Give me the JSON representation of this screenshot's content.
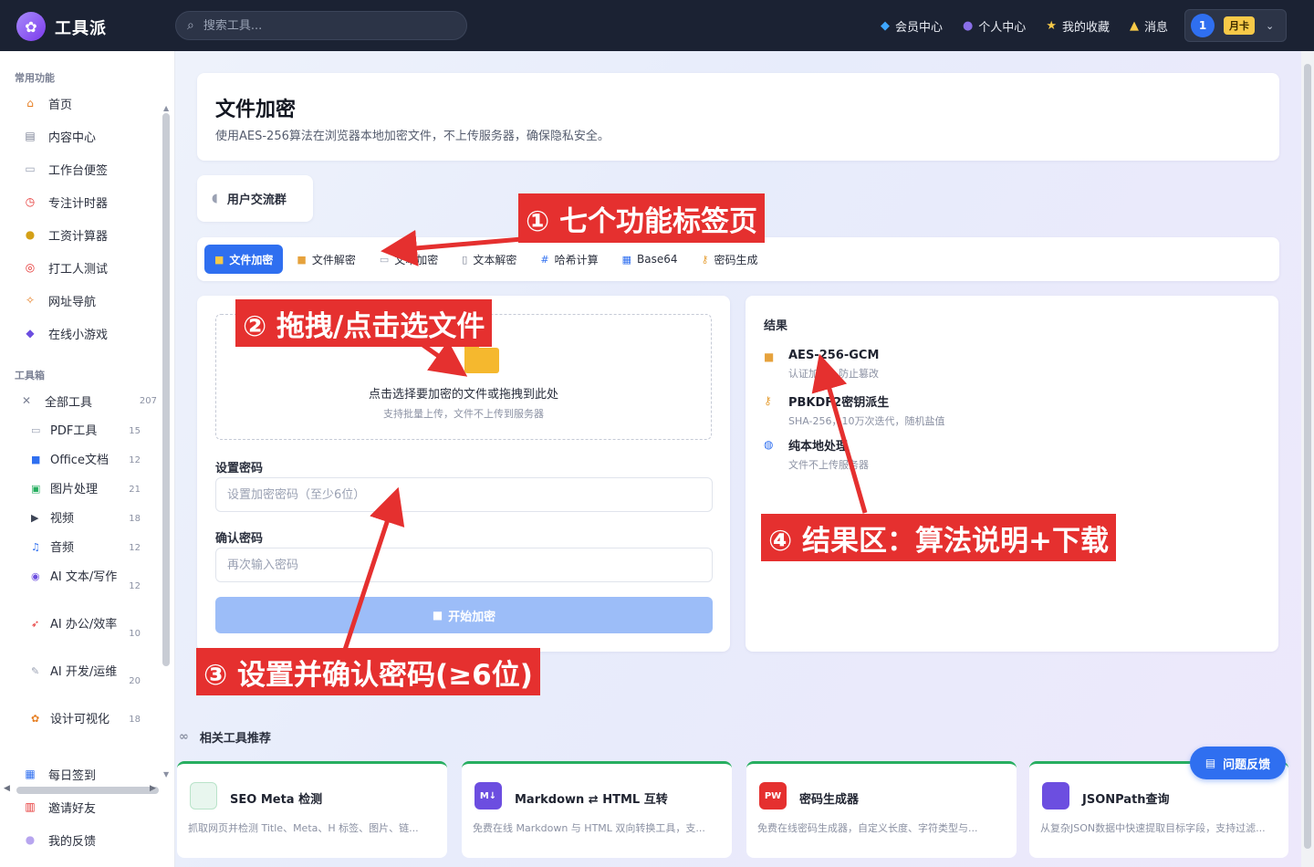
{
  "header": {
    "logo_text": "工具派",
    "search_placeholder": "搜索工具...",
    "nav": [
      {
        "label": "会员中心",
        "icon": "gem-icon"
      },
      {
        "label": "个人中心",
        "icon": "user-icon"
      },
      {
        "label": "我的收藏",
        "icon": "star-icon"
      },
      {
        "label": "消息",
        "icon": "bell-icon"
      }
    ],
    "user_avatar": "1",
    "user_badge": "月卡"
  },
  "sidebar": {
    "section_common": "常用功能",
    "common_items": [
      {
        "label": "首页",
        "icon": "home-icon"
      },
      {
        "label": "内容中心",
        "icon": "news-icon"
      },
      {
        "label": "工作台便签",
        "icon": "note-icon"
      },
      {
        "label": "专注计时器",
        "icon": "timer-icon"
      },
      {
        "label": "工资计算器",
        "icon": "money-bag-icon"
      },
      {
        "label": "打工人测试",
        "icon": "target-icon"
      },
      {
        "label": "网址导航",
        "icon": "compass-icon"
      },
      {
        "label": "在线小游戏",
        "icon": "gamepad-icon"
      }
    ],
    "section_tools": "工具箱",
    "all_tools": {
      "label": "全部工具",
      "count": "207"
    },
    "tool_items": [
      {
        "label": "PDF工具",
        "count": "15",
        "icon": "pdf-icon"
      },
      {
        "label": "Office文档",
        "count": "12",
        "icon": "office-icon"
      },
      {
        "label": "图片处理",
        "count": "21",
        "icon": "image-icon"
      },
      {
        "label": "视频",
        "count": "18",
        "icon": "video-icon"
      },
      {
        "label": "音频",
        "count": "12",
        "icon": "music-icon"
      },
      {
        "label": "AI 文本/写作",
        "count": "12",
        "icon": "robot-icon"
      },
      {
        "label": "AI 办公/效率",
        "count": "10",
        "icon": "rocket-icon"
      },
      {
        "label": "AI 开发/运维",
        "count": "20",
        "icon": "wrench-icon"
      },
      {
        "label": "设计可视化",
        "count": "18",
        "icon": "palette-icon"
      }
    ],
    "bottom_items": [
      {
        "label": "每日签到",
        "icon": "calendar-icon"
      },
      {
        "label": "邀请好友",
        "icon": "gift-icon"
      },
      {
        "label": "我的反馈",
        "icon": "chat-icon"
      }
    ]
  },
  "hero": {
    "title": "文件加密",
    "desc": "使用AES-256算法在浏览器本地加密文件，不上传服务器，确保隐私安全。"
  },
  "group_button": "用户交流群",
  "tabs": [
    {
      "label": "文件加密",
      "icon": "lock-icon",
      "active": true
    },
    {
      "label": "文件解密",
      "icon": "unlock-icon"
    },
    {
      "label": "文本加密",
      "icon": "doc-icon"
    },
    {
      "label": "文本解密",
      "icon": "book-icon"
    },
    {
      "label": "哈希计算",
      "icon": "hash-icon"
    },
    {
      "label": "Base64",
      "icon": "grid-icon"
    },
    {
      "label": "密码生成",
      "icon": "key-icon"
    }
  ],
  "upload": {
    "main_text": "点击选择要加密的文件或拖拽到此处",
    "sub_text": "支持批量上传，文件不上传到服务器",
    "password_label": "设置密码",
    "password_placeholder": "设置加密密码（至少6位）",
    "confirm_label": "确认密码",
    "confirm_placeholder": "再次输入密码",
    "start_button": "开始加密"
  },
  "result": {
    "title": "结果",
    "items": [
      {
        "title": "AES-256-GCM",
        "desc": "认证加密，防止篡改",
        "icon": "lock-icon"
      },
      {
        "title": "PBKDF2密钥派生",
        "desc": "SHA-256，10万次迭代，随机盐值",
        "icon": "key-icon"
      },
      {
        "title": "纯本地处理",
        "desc": "文件不上传服务器",
        "icon": "globe-icon"
      }
    ]
  },
  "related": {
    "title": "相关工具推荐",
    "cards": [
      {
        "title": "SEO Meta 检测",
        "desc": "抓取网页并检测 Title、Meta、H 标签、图片、链...",
        "icon_text": "",
        "color": "#e8f6ee"
      },
      {
        "title": "Markdown ⇄ HTML 互转",
        "desc": "免费在线 Markdown 与 HTML 双向转换工具，支...",
        "icon_text": "M↓",
        "color": "#6c4ee0"
      },
      {
        "title": "密码生成器",
        "desc": "免费在线密码生成器，自定义长度、字符类型与...",
        "icon_text": "PW",
        "color": "#e5302f"
      },
      {
        "title": "JSONPath查询",
        "desc": "从复杂JSON数据中快速提取目标字段，支持过滤...",
        "icon_text": "",
        "color": "#6c4ee0"
      }
    ]
  },
  "feedback_button": "问题反馈",
  "annotations": [
    "① 七个功能标签页",
    "② 拖拽/点击选文件",
    "③ 设置并确认密码(≥6位)",
    "④ 结果区：算法说明+下载"
  ],
  "colors": {
    "primary": "#2f6ff0",
    "topbar": "#1b2233",
    "annotation": "#e5302f",
    "badge": "#f7c948"
  }
}
